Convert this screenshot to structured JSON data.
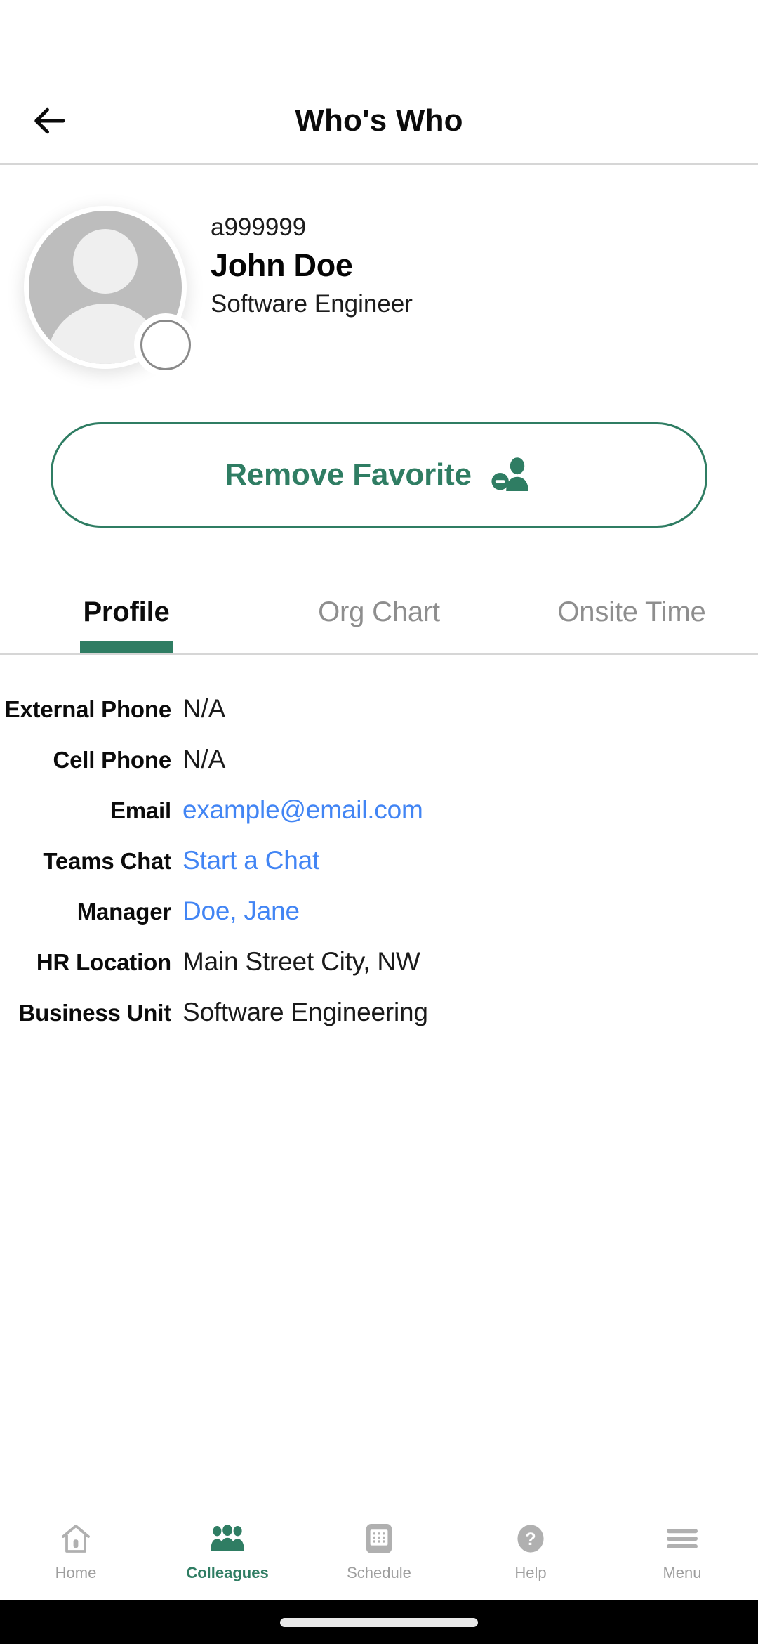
{
  "header": {
    "title": "Who's Who",
    "back_icon": "arrow-left-icon"
  },
  "profile": {
    "employee_id": "a999999",
    "name": "John Doe",
    "job_title": "Software Engineer",
    "avatar_icon": "person-avatar-placeholder-icon",
    "status_badge_icon": "presence-status-icon"
  },
  "favorite_button": {
    "label": "Remove Favorite",
    "icon": "person-remove-icon",
    "color": "#2f7d63"
  },
  "tabs": {
    "active_index": 0,
    "items": [
      {
        "label": "Profile"
      },
      {
        "label": "Org Chart"
      },
      {
        "label": "Onsite Time"
      }
    ],
    "indicator_color": "#2f7d63"
  },
  "details": {
    "rows": [
      {
        "label": "External Phone",
        "value": "N/A",
        "link": false
      },
      {
        "label": "Cell Phone",
        "value": "N/A",
        "link": false
      },
      {
        "label": "Email",
        "value": "example@email.com",
        "link": true
      },
      {
        "label": "Teams Chat",
        "value": "Start a Chat",
        "link": true
      },
      {
        "label": "Manager",
        "value": "Doe, Jane",
        "link": true
      },
      {
        "label": "HR Location",
        "value": "Main Street City, NW",
        "link": false
      },
      {
        "label": "Business Unit",
        "value": "Software Engineering",
        "link": false
      }
    ],
    "link_color": "#4285f4"
  },
  "bottom_nav": {
    "active_index": 1,
    "items": [
      {
        "label": "Home",
        "icon": "home-icon"
      },
      {
        "label": "Colleagues",
        "icon": "people-group-icon"
      },
      {
        "label": "Schedule",
        "icon": "calendar-keypad-icon"
      },
      {
        "label": "Help",
        "icon": "question-circle-icon"
      },
      {
        "label": "Menu",
        "icon": "hamburger-menu-icon"
      }
    ],
    "active_color": "#2f7d63",
    "inactive_color": "#9e9e9e"
  },
  "system_nav": {
    "home_indicator": "home-indicator-pill"
  }
}
